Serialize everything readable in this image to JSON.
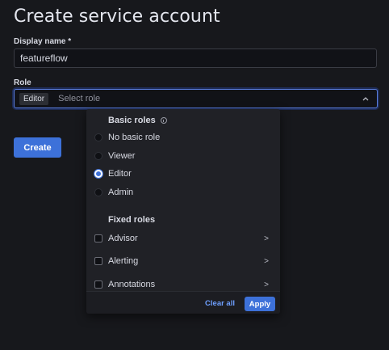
{
  "page": {
    "title": "Create service account"
  },
  "form": {
    "display_name_label": "Display name *",
    "display_name_value": "featureflow",
    "role_label": "Role",
    "role_tag": "Editor",
    "role_placeholder": "Select role",
    "create_label": "Create"
  },
  "dropdown": {
    "basic_roles_title": "Basic roles",
    "basic_roles": [
      {
        "label": "No basic role",
        "checked": false
      },
      {
        "label": "Viewer",
        "checked": false
      },
      {
        "label": "Editor",
        "checked": true
      },
      {
        "label": "Admin",
        "checked": false
      }
    ],
    "fixed_roles_title": "Fixed roles",
    "fixed_roles": [
      {
        "label": "Advisor",
        "arrow": ">"
      },
      {
        "label": "Alerting",
        "arrow": ">"
      },
      {
        "label": "Annotations",
        "arrow": ">"
      }
    ],
    "clear_label": "Clear all",
    "apply_label": "Apply"
  },
  "colors": {
    "accent": "#3d71d9",
    "background": "#17181c",
    "link": "#6e9fff"
  }
}
